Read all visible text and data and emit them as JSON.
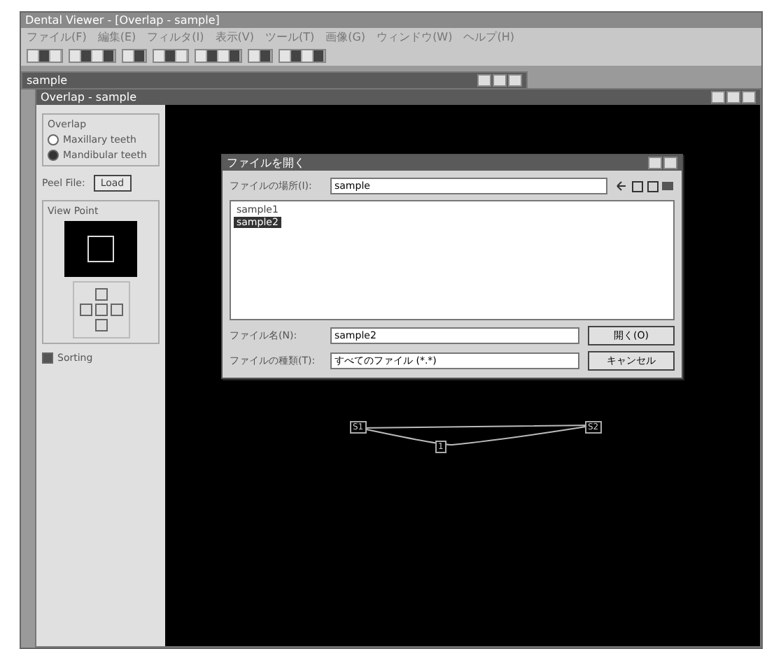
{
  "app": {
    "title": "Dental Viewer - [Overlap - sample]"
  },
  "menu": [
    "ファイル(F)",
    "編集(E)",
    "フィルタ(I)",
    "表示(V)",
    "ツール(T)",
    "画像(G)",
    "ウィンドウ(W)",
    "ヘルプ(H)"
  ],
  "mdi_window": {
    "title": "sample"
  },
  "child_window": {
    "title": "Overlap - sample"
  },
  "panel": {
    "group_title": "Overlap",
    "radios": [
      {
        "label": "Maxillary teeth",
        "selected": false
      },
      {
        "label": "Mandibular teeth",
        "selected": true
      }
    ],
    "peel_file_label": "Peel File:",
    "load_button": "Load",
    "view_point_title": "View Point",
    "checkbox": {
      "label": "Sorting",
      "checked": true
    }
  },
  "dialog": {
    "title": "ファイルを開く",
    "location_label": "ファイルの場所(I):",
    "location_value": "sample",
    "files": [
      {
        "name": "sample1",
        "selected": false
      },
      {
        "name": "sample2",
        "selected": true
      }
    ],
    "filename_label": "ファイル名(N):",
    "filename_value": "sample2",
    "filetype_label": "ファイルの種類(T):",
    "filetype_value": "すべてのファイル (*.*)",
    "buttons": [
      "開く(O)",
      "キャンセル"
    ]
  },
  "canvas": {
    "markers": [
      "S1",
      "1",
      "S2"
    ]
  }
}
